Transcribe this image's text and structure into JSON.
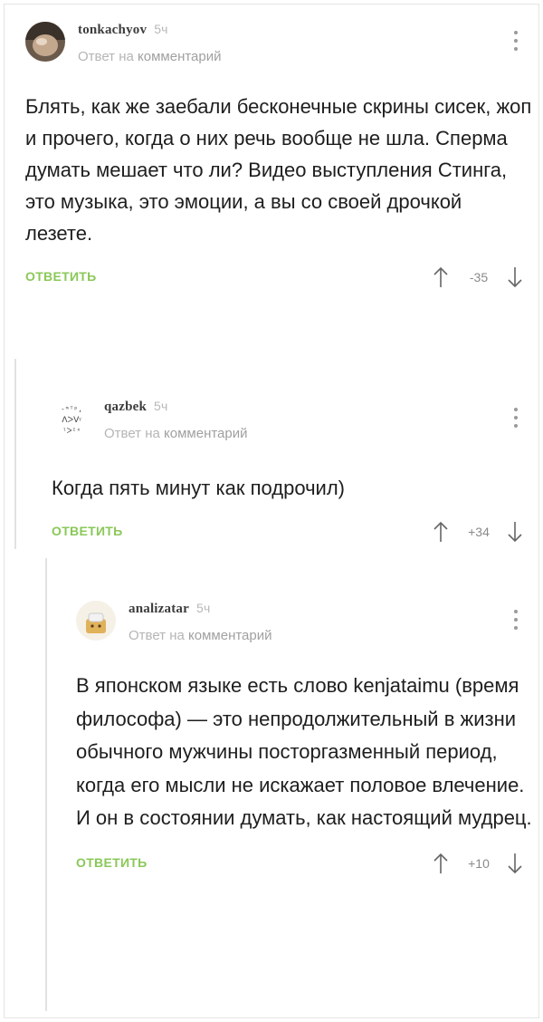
{
  "comments": [
    {
      "username": "tonkachyov",
      "time": "5ч",
      "reply_prefix": "Ответ на",
      "reply_link": "комментарий",
      "text": "Блять, как же заебали бесконечные скрины сисек, жоп и прочего, когда о них речь вообще не шла. Сперма думать мешает что ли? Видео выступления Стинга, это музыка, это эмоции, а вы со своей дрочкой лезете.",
      "reply_label": "ОТВЕТИТЬ",
      "score": "-35"
    },
    {
      "username": "qazbek",
      "time": "5ч",
      "reply_prefix": "Ответ на",
      "reply_link": "комментарий",
      "text": "Когда пять минут как подрочил)",
      "reply_label": "ОТВЕТИТЬ",
      "score": "+34"
    },
    {
      "username": "analizatar",
      "time": "5ч",
      "reply_prefix": "Ответ на",
      "reply_link": "комментарий",
      "text": "В японском языке есть слово kenjataimu (время философа) — это непродолжительный в жизни обычного мужчины посторгазменный период, когда его мысли не искажает половое влечение. И он в состоянии думать, как настоящий мудрец.",
      "reply_label": "ОТВЕТИТЬ",
      "score": "+10"
    }
  ],
  "colors": {
    "reply": "#8ac858",
    "meta": "#b5b5b5",
    "text": "#1e1e1e"
  }
}
